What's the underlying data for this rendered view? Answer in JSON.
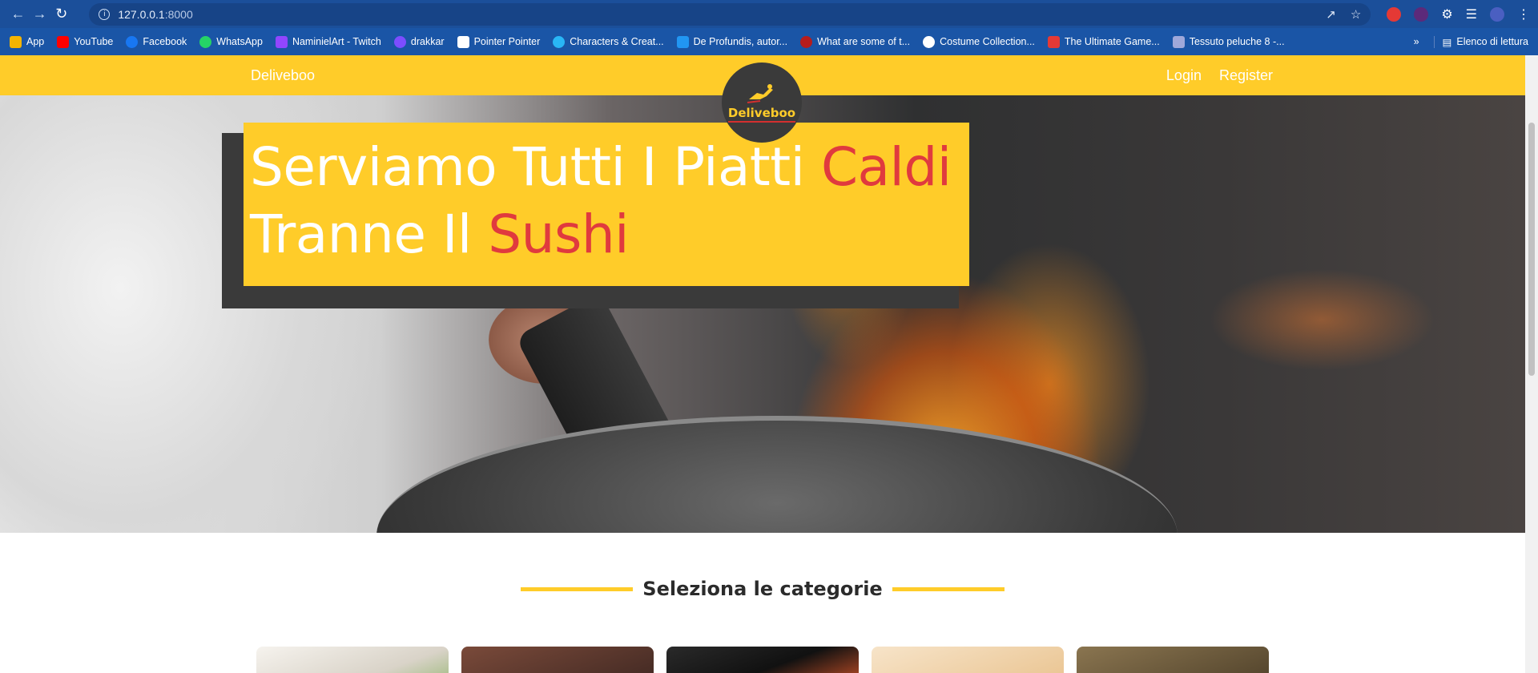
{
  "browser": {
    "url_host": "127.0.0.1",
    "url_port": ":8000",
    "bookmarks": [
      {
        "label": "App",
        "color": "#f4b400"
      },
      {
        "label": "YouTube",
        "color": "#ff0000"
      },
      {
        "label": "Facebook",
        "color": "#1877f2"
      },
      {
        "label": "WhatsApp",
        "color": "#25d366"
      },
      {
        "label": "NaminielArt - Twitch",
        "color": "#9146ff"
      },
      {
        "label": "drakkar",
        "color": "#7c4dff"
      },
      {
        "label": "Pointer Pointer",
        "color": "#ffffff"
      },
      {
        "label": "Characters & Creat...",
        "color": "#29b6f6"
      },
      {
        "label": "De Profundis, autor...",
        "color": "#2196f3"
      },
      {
        "label": "What are some of t...",
        "color": "#b71c1c"
      },
      {
        "label": "Costume Collection...",
        "color": "#ffffff"
      },
      {
        "label": "The Ultimate Game...",
        "color": "#e53935"
      },
      {
        "label": "Tessuto peluche 8 -...",
        "color": "#9fa8da"
      }
    ],
    "overflow": "»",
    "reading_list": "Elenco di lettura"
  },
  "site": {
    "brand": "Deliveboo",
    "login": "Login",
    "register": "Register",
    "logo_text": "Deliveboo"
  },
  "hero": {
    "line1_pre": "Serviamo Tutti I Piatti ",
    "line1_hl": "Caldi",
    "line2_pre": "Tranne Il ",
    "line2_hl": "Sushi"
  },
  "categories": {
    "title": "Seleziona le categorie",
    "cards": [
      {
        "color": "#e8e4dc"
      },
      {
        "color": "#5a3a30"
      },
      {
        "color": "#1e1e1e"
      },
      {
        "color": "#f0d9b8"
      },
      {
        "color": "#6b5a3c"
      }
    ]
  }
}
